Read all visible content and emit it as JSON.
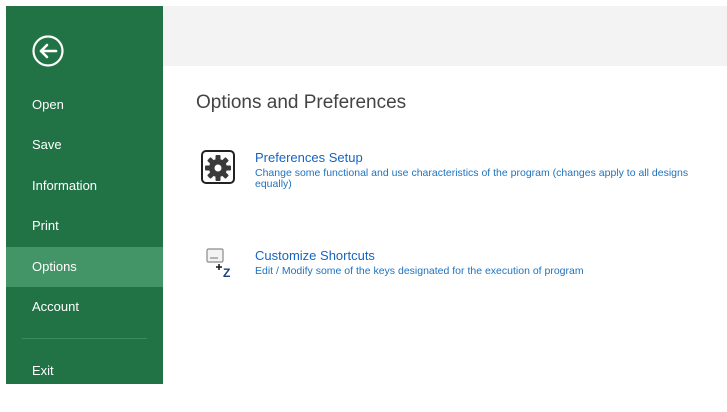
{
  "colors": {
    "sidebar_bg": "#217346",
    "sidebar_selected_bg": "#439467",
    "link_blue": "#1565c0",
    "header_band_bg": "#f3f3f3"
  },
  "sidebar": {
    "back_icon": "back-arrow-circle-icon",
    "items": [
      {
        "label": "Open",
        "selected": false
      },
      {
        "label": "Save",
        "selected": false
      },
      {
        "label": "Information",
        "selected": false
      },
      {
        "label": "Print",
        "selected": false
      },
      {
        "label": "Options",
        "selected": true
      },
      {
        "label": "Account",
        "selected": false
      },
      {
        "label": "Exit",
        "selected": false
      }
    ]
  },
  "main": {
    "title": "Options and Preferences",
    "options": [
      {
        "icon": "gear-icon",
        "title": "Preferences Setup",
        "description": "Change some functional and use characteristics of the program (changes apply to all designs equally)"
      },
      {
        "icon": "keyboard-shortcut-icon",
        "title": "Customize Shortcuts",
        "description": "Edit / Modify some of the keys designated for the execution of program"
      }
    ]
  }
}
